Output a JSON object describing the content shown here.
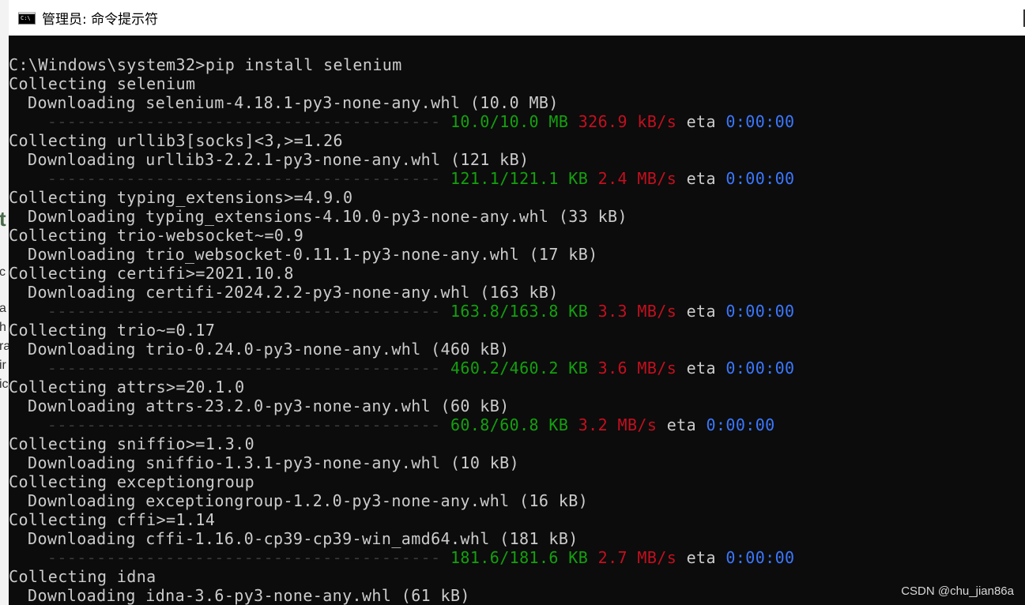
{
  "window": {
    "title": "管理员: 命令提示符",
    "icon": "console-app-icon",
    "icon_text": "C:\\"
  },
  "background_fragments": [
    "t",
    "c",
    "a",
    "h",
    "ra",
    "ir",
    "ic"
  ],
  "colors": {
    "console_bg": "#0c0c0c",
    "text": "#cccccc",
    "progress_green": "#13a10e",
    "speed_red": "#c50f1f",
    "eta_blue": "#3b78ff"
  },
  "console": {
    "command": "C:\\Windows\\system32>pip install selenium",
    "progress_bar": "----------------------------------------",
    "eta_label": "eta",
    "lines": [
      {
        "text": "Collecting selenium"
      },
      {
        "indent": true,
        "text": "Downloading selenium-4.18.1-py3-none-any.whl (10.0 MB)"
      },
      {
        "progress": true,
        "size": "10.0/10.0 MB",
        "speed": "326.9 kB/s",
        "time": "0:00:00"
      },
      {
        "text": "Collecting urllib3[socks]<3,>=1.26"
      },
      {
        "indent": true,
        "text": "Downloading urllib3-2.2.1-py3-none-any.whl (121 kB)"
      },
      {
        "progress": true,
        "size": "121.1/121.1 KB",
        "speed": "2.4 MB/s",
        "time": "0:00:00"
      },
      {
        "text": "Collecting typing_extensions>=4.9.0"
      },
      {
        "indent": true,
        "text": "Downloading typing_extensions-4.10.0-py3-none-any.whl (33 kB)"
      },
      {
        "text": "Collecting trio-websocket~=0.9"
      },
      {
        "indent": true,
        "text": "Downloading trio_websocket-0.11.1-py3-none-any.whl (17 kB)"
      },
      {
        "text": "Collecting certifi>=2021.10.8"
      },
      {
        "indent": true,
        "text": "Downloading certifi-2024.2.2-py3-none-any.whl (163 kB)"
      },
      {
        "progress": true,
        "size": "163.8/163.8 KB",
        "speed": "3.3 MB/s",
        "time": "0:00:00"
      },
      {
        "text": "Collecting trio~=0.17"
      },
      {
        "indent": true,
        "text": "Downloading trio-0.24.0-py3-none-any.whl (460 kB)"
      },
      {
        "progress": true,
        "size": "460.2/460.2 KB",
        "speed": "3.6 MB/s",
        "time": "0:00:00"
      },
      {
        "text": "Collecting attrs>=20.1.0"
      },
      {
        "indent": true,
        "text": "Downloading attrs-23.2.0-py3-none-any.whl (60 kB)"
      },
      {
        "progress": true,
        "size": "60.8/60.8 KB",
        "speed": "3.2 MB/s",
        "time": "0:00:00"
      },
      {
        "text": "Collecting sniffio>=1.3.0"
      },
      {
        "indent": true,
        "text": "Downloading sniffio-1.3.1-py3-none-any.whl (10 kB)"
      },
      {
        "text": "Collecting exceptiongroup"
      },
      {
        "indent": true,
        "text": "Downloading exceptiongroup-1.2.0-py3-none-any.whl (16 kB)"
      },
      {
        "text": "Collecting cffi>=1.14"
      },
      {
        "indent": true,
        "text": "Downloading cffi-1.16.0-cp39-cp39-win_amd64.whl (181 kB)"
      },
      {
        "progress": true,
        "size": "181.6/181.6 KB",
        "speed": "2.7 MB/s",
        "time": "0:00:00"
      },
      {
        "text": "Collecting idna"
      },
      {
        "indent": true,
        "text": "Downloading idna-3.6-py3-none-any.whl (61 kB)"
      }
    ]
  },
  "watermark": "CSDN @chu_jian86a"
}
